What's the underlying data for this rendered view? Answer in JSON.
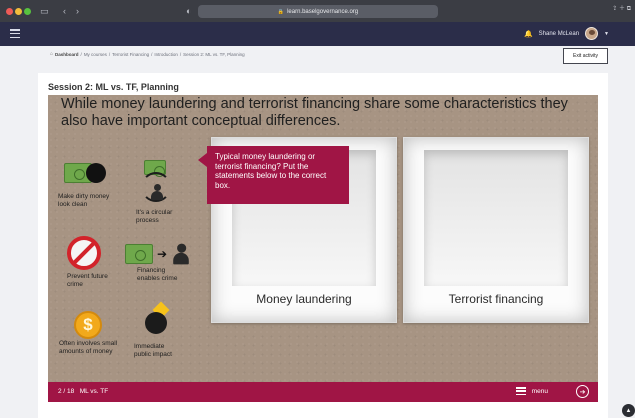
{
  "browser": {
    "url": "learn.baselgovernance.org",
    "back_icon": "chevron-left-icon",
    "forward_icon": "chevron-right-icon"
  },
  "nav": {
    "user_name": "Shane McLean",
    "bell_icon": "bell-icon"
  },
  "breadcrumb": {
    "dashboard": "Dashboard",
    "items": [
      "My courses",
      "Terrorist Financing",
      "Introduction",
      "Session 2: ML vs. TF, Planning"
    ]
  },
  "exit_label": "Exit activity",
  "session_title": "Session 2: ML vs. TF, Planning",
  "slide": {
    "heading": "While money laundering and terrorist financing share some characteristics they also have important conceptual differences.",
    "tooltip": "Typical money laundering or terrorist financing? Put the statements below to the correct box.",
    "boxes": [
      "Money laundering",
      "Terrorist financing"
    ],
    "statements": [
      "Make dirty money look clean",
      "It's a circular process",
      "Prevent future crime",
      "Financing enables crime",
      "Often involves small amounts of money",
      "Immediate public impact"
    ]
  },
  "footer": {
    "page": "2 / 18",
    "section": "ML vs. TF",
    "menu_label": "menu"
  },
  "colors": {
    "accent": "#a01545",
    "nav_bg": "#2b2d49",
    "slide_bg": "#a79483"
  }
}
